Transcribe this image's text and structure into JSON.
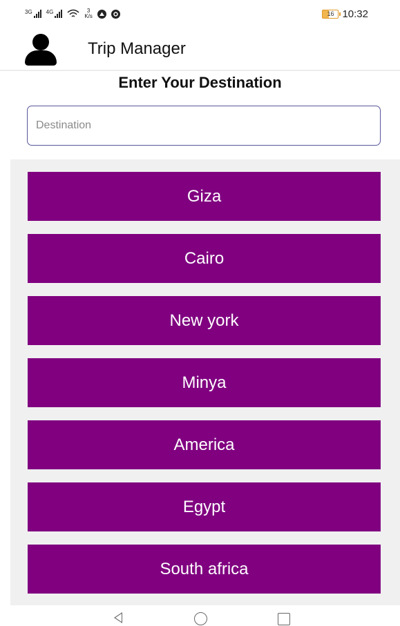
{
  "status_bar": {
    "network_1": "3G",
    "network_2": "4G",
    "data_speed_value": "3",
    "data_speed_unit": "K/s",
    "battery": "16",
    "time": "10:32"
  },
  "app_bar": {
    "title": "Trip Manager",
    "avatar_icon": "person-icon"
  },
  "page": {
    "heading": "Enter Your Destination"
  },
  "search": {
    "value": "",
    "placeholder": "Destination"
  },
  "destinations": [
    {
      "label": "Giza"
    },
    {
      "label": "Cairo"
    },
    {
      "label": "New york"
    },
    {
      "label": "Minya"
    },
    {
      "label": "America"
    },
    {
      "label": "Egypt"
    },
    {
      "label": "South africa"
    }
  ],
  "colors": {
    "item_background": "#800080",
    "item_text": "#ffffff",
    "list_background": "#f0f0f0",
    "input_border": "#55549a"
  },
  "nav_bar": {
    "back_icon": "back-triangle-icon",
    "home_icon": "home-circle-icon",
    "recents_icon": "recents-square-icon"
  }
}
